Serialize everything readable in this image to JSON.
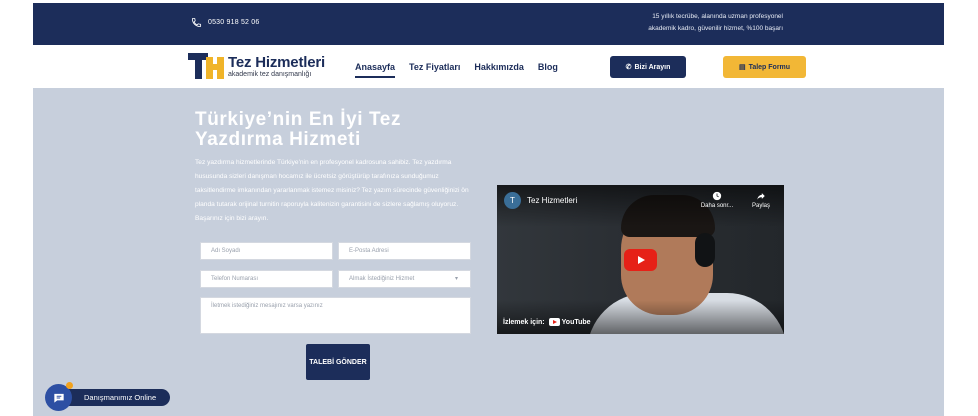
{
  "topbar": {
    "phone": "0530 918 52 06",
    "tagline_line1": "15 yıllık tecrübe, alanında uzman profesyonel",
    "tagline_line2": "akademik kadro, güvenilir hizmet, %100 başarı"
  },
  "header": {
    "logo_title": "Tez Hizmetleri",
    "logo_subtitle": "akademik tez danışmanlığı",
    "nav": [
      {
        "label": "Anasayfa",
        "active": true
      },
      {
        "label": "Tez Fiyatları",
        "active": false
      },
      {
        "label": "Hakkımızda",
        "active": false
      },
      {
        "label": "Blog",
        "active": false
      }
    ],
    "call_button": "Bizi Arayın",
    "form_button": "Talep Formu"
  },
  "hero": {
    "title": "Türkiye’nin En İyi Tez Yazdırma Hizmeti",
    "description": "Tez yazdırma hizmetlerinde Türkiye'nin en profesyonel kadrosuna sahibiz. Tez yazdırma hususunda sizleri danışman hocamız ile ücretsiz görüştürüp tarafınıza sunduğumuz taksitlendirme imkanından yararlanmak istemez misiniz? Tez yazım sürecinde güvenliğinizi ön planda tutarak orijinal turnitin raporuyla kalitenizin garantisini de sizlere sağlamış oluyoruz. Başarınız için bizi arayın."
  },
  "form": {
    "name_placeholder": "Adı Soyadı",
    "email_placeholder": "E-Posta Adresi",
    "phone_placeholder": "Telefon Numarası",
    "service_placeholder": "Almak İstediğiniz Hizmet",
    "message_placeholder": "İletmek istediğiniz mesajınız varsa yazınız",
    "submit_label": "TALEBİ GÖNDER"
  },
  "video": {
    "channel_initial": "T",
    "channel_name": "Tez Hizmetleri",
    "watch_later": "Daha sonr...",
    "share": "Paylaş",
    "watch_on": "İzlemek için:",
    "youtube": "YouTube"
  },
  "chat": {
    "label": "Danışmanımız Online"
  },
  "colors": {
    "navy": "#1c2d5a",
    "gold": "#f2b736",
    "hero_bg": "#c7cfdc",
    "youtube_red": "#e62117"
  }
}
